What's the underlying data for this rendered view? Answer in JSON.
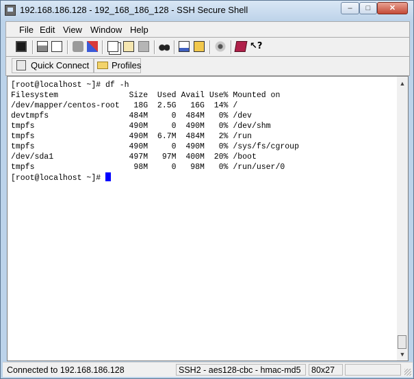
{
  "window": {
    "title": "192.168.186.128 - 192_168_186_128 - SSH Secure Shell",
    "buttons": {
      "minimize": "–",
      "maximize": "□",
      "close": "✕"
    }
  },
  "menu": [
    "File",
    "Edit",
    "View",
    "Window",
    "Help"
  ],
  "toolbar": {
    "icons": [
      "save-icon",
      "print-icon",
      "print-preview-icon",
      "disconnect-icon",
      "reconnect-icon",
      "copy-icon",
      "paste-icon",
      "paste-clipboard-icon",
      "find-icon",
      "new-terminal-icon",
      "file-transfer-icon",
      "settings-icon",
      "book-icon",
      "help-icon"
    ]
  },
  "quickbar": {
    "quick_connect": "Quick Connect",
    "profiles": "Profiles"
  },
  "terminal": {
    "lines": [
      "[root@localhost ~]# df -h",
      "Filesystem               Size  Used Avail Use% Mounted on",
      "/dev/mapper/centos-root   18G  2.5G   16G  14% /",
      "devtmpfs                 484M     0  484M   0% /dev",
      "tmpfs                    490M     0  490M   0% /dev/shm",
      "tmpfs                    490M  6.7M  484M   2% /run",
      "tmpfs                    490M     0  490M   0% /sys/fs/cgroup",
      "/dev/sda1                497M   97M  400M  20% /boot",
      "tmpfs                     98M     0   98M   0% /run/user/0"
    ],
    "prompt": "[root@localhost ~]# "
  },
  "status": {
    "connection": "Connected to 192.168.186.128",
    "cipher": "SSH2 - aes128-cbc - hmac-md5",
    "size": "80x27"
  },
  "colors": {
    "cursor": "#0000ff",
    "title_bg": "#bfd4ea"
  }
}
